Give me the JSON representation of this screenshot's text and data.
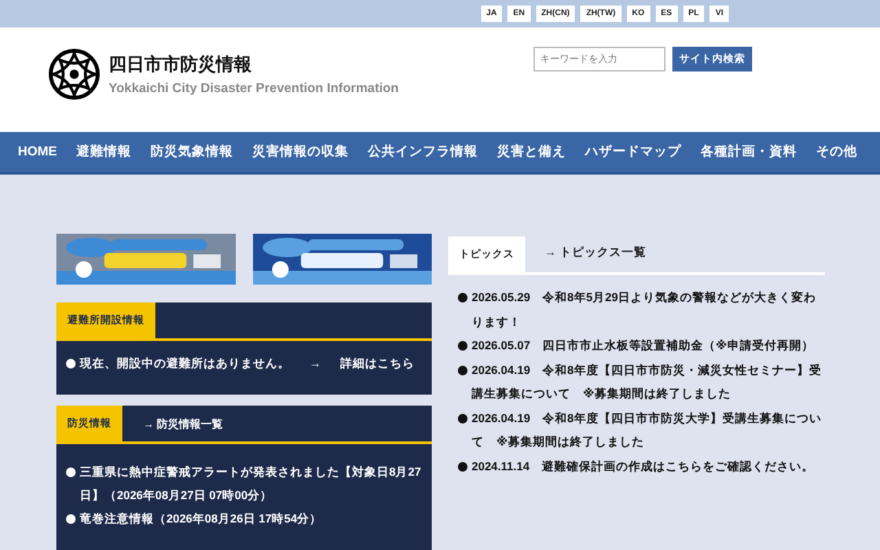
{
  "languages": [
    {
      "label": "JA"
    },
    {
      "label": "EN"
    },
    {
      "label": "ZH(CN)"
    },
    {
      "label": "ZH(TW)"
    },
    {
      "label": "KO"
    },
    {
      "label": "ES"
    },
    {
      "label": "PL"
    },
    {
      "label": "VI"
    }
  ],
  "header": {
    "title": "四日市市防災情報",
    "subtitle": "Yokkaichi City Disaster Prevention Information",
    "search": {
      "placeholder": "キーワードを入力",
      "button": "サイト内検索"
    }
  },
  "nav": [
    "HOME",
    "避難情報",
    "防災気象情報",
    "災害情報の収集",
    "公共インフラ情報",
    "災害と備え",
    "ハザードマップ",
    "各種計画・資料",
    "その他"
  ],
  "shelter_panel": {
    "title": "避難所開設情報",
    "items": [
      {
        "text": "現在、開設中の避難所はありません。",
        "arrow": "→",
        "link": "詳細はこちら"
      }
    ]
  },
  "disaster_panel": {
    "title": "防災情報",
    "link": "→ 防災情報一覧",
    "items": [
      "三重県に熱中症警戒アラートが発表されました【対象日8月27日】（2026年08月27日 07時00分）",
      "竜巻注意情報（2026年08月26日 17時54分）"
    ]
  },
  "topics": {
    "tabs": [
      {
        "label": "トピックス",
        "selected": true
      },
      {
        "label": "→ トピックス一覧",
        "selected": false
      }
    ],
    "items": [
      {
        "date": "2026.05.29",
        "text": "令和8年5月29日より気象の警報などが大きく変わります！"
      },
      {
        "date": "2026.05.07",
        "text": "四日市市止水板等設置補助金（※申請受付再開）"
      },
      {
        "date": "2026.04.19",
        "text": "令和8年度【四日市市防災・減災女性セミナー】受講生募集について　※募集期間は終了しました"
      },
      {
        "date": "2026.04.19",
        "text": "令和8年度【四日市市防災大学】受講生募集について　※募集期間は終了しました"
      },
      {
        "date": "2024.11.14",
        "text": "避難確保計画の作成はこちらをご確認ください。"
      }
    ]
  }
}
